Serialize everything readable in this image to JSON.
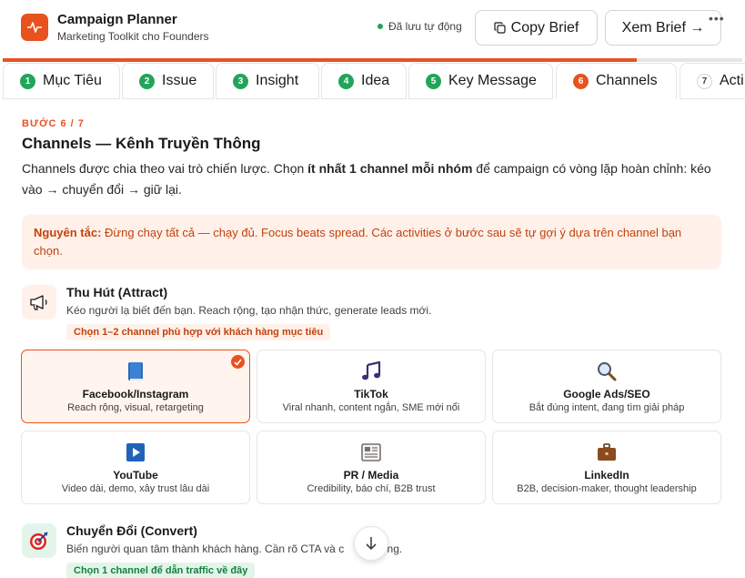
{
  "app": {
    "title": "Campaign Planner",
    "subtitle": "Marketing Toolkit cho Founders",
    "autosave": "Đã lưu tự động",
    "copy_label": "Copy Brief",
    "view_label": "Xem Brief →",
    "progress_fraction": 0.857
  },
  "tabs": [
    {
      "num": "1",
      "label": "Mục Tiêu",
      "state": "done"
    },
    {
      "num": "2",
      "label": "Issue",
      "state": "done"
    },
    {
      "num": "3",
      "label": "Insight",
      "state": "done"
    },
    {
      "num": "4",
      "label": "Idea",
      "state": "done"
    },
    {
      "num": "5",
      "label": "Key Message",
      "state": "done"
    },
    {
      "num": "6",
      "label": "Channels",
      "state": "active"
    },
    {
      "num": "7",
      "label": "Acti",
      "state": "todo"
    }
  ],
  "step": {
    "label": "BƯỚC 6 / 7",
    "title": "Channels — Kênh Truyền Thông",
    "desc_before": "Channels được chia theo vai trò chiến lược. Chọn ",
    "desc_bold": "ít nhất 1 channel mỗi nhóm",
    "desc_after": " để campaign có vòng lặp hoàn chỉnh: kéo vào → chuyển đổi → giữ lại."
  },
  "rule": {
    "label": "Nguyên tắc:",
    "text": " Đừng chạy tất cả — chạy đủ. Focus beats spread. Các activities ở bước sau sẽ tự gợi ý dựa trên channel bạn chọn."
  },
  "attract": {
    "icon": "megaphone-icon",
    "title": "Thu Hút (Attract)",
    "desc": "Kéo người lạ biết đến bạn. Reach rộng, tạo nhận thức, generate leads mới.",
    "hint": "Chọn 1–2 channel phù hợp với khách hàng mục tiêu",
    "cards": [
      {
        "name": "Facebook/Instagram",
        "sub": "Reach rộng, visual, retargeting",
        "icon": "book-icon",
        "selected": true
      },
      {
        "name": "TikTok",
        "sub": "Viral nhanh, content ngắn, SME mới nổi",
        "icon": "music-note-icon",
        "selected": false
      },
      {
        "name": "Google Ads/SEO",
        "sub": "Bắt đúng intent, đang tìm giải pháp",
        "icon": "magnifier-icon",
        "selected": false
      },
      {
        "name": "YouTube",
        "sub": "Video dài, demo, xây trust lâu dài",
        "icon": "play-icon",
        "selected": false
      },
      {
        "name": "PR / Media",
        "sub": "Credibility, báo chí, B2B trust",
        "icon": "newspaper-icon",
        "selected": false
      },
      {
        "name": "LinkedIn",
        "sub": "B2B, decision-maker, thought leadership",
        "icon": "briefcase-icon",
        "selected": false
      }
    ]
  },
  "convert": {
    "icon": "target-icon",
    "title": "Chuyển Đổi (Convert)",
    "desc": "Biến người quan tâm thành khách hàng. Cần rõ CTA và c",
    "desc_tail": "h động.",
    "hint": "Chọn 1 channel để dẫn traffic về đây"
  },
  "colors": {
    "accent": "#e8521f",
    "done": "#22a55a",
    "hint_bg": "#fff1ea"
  }
}
